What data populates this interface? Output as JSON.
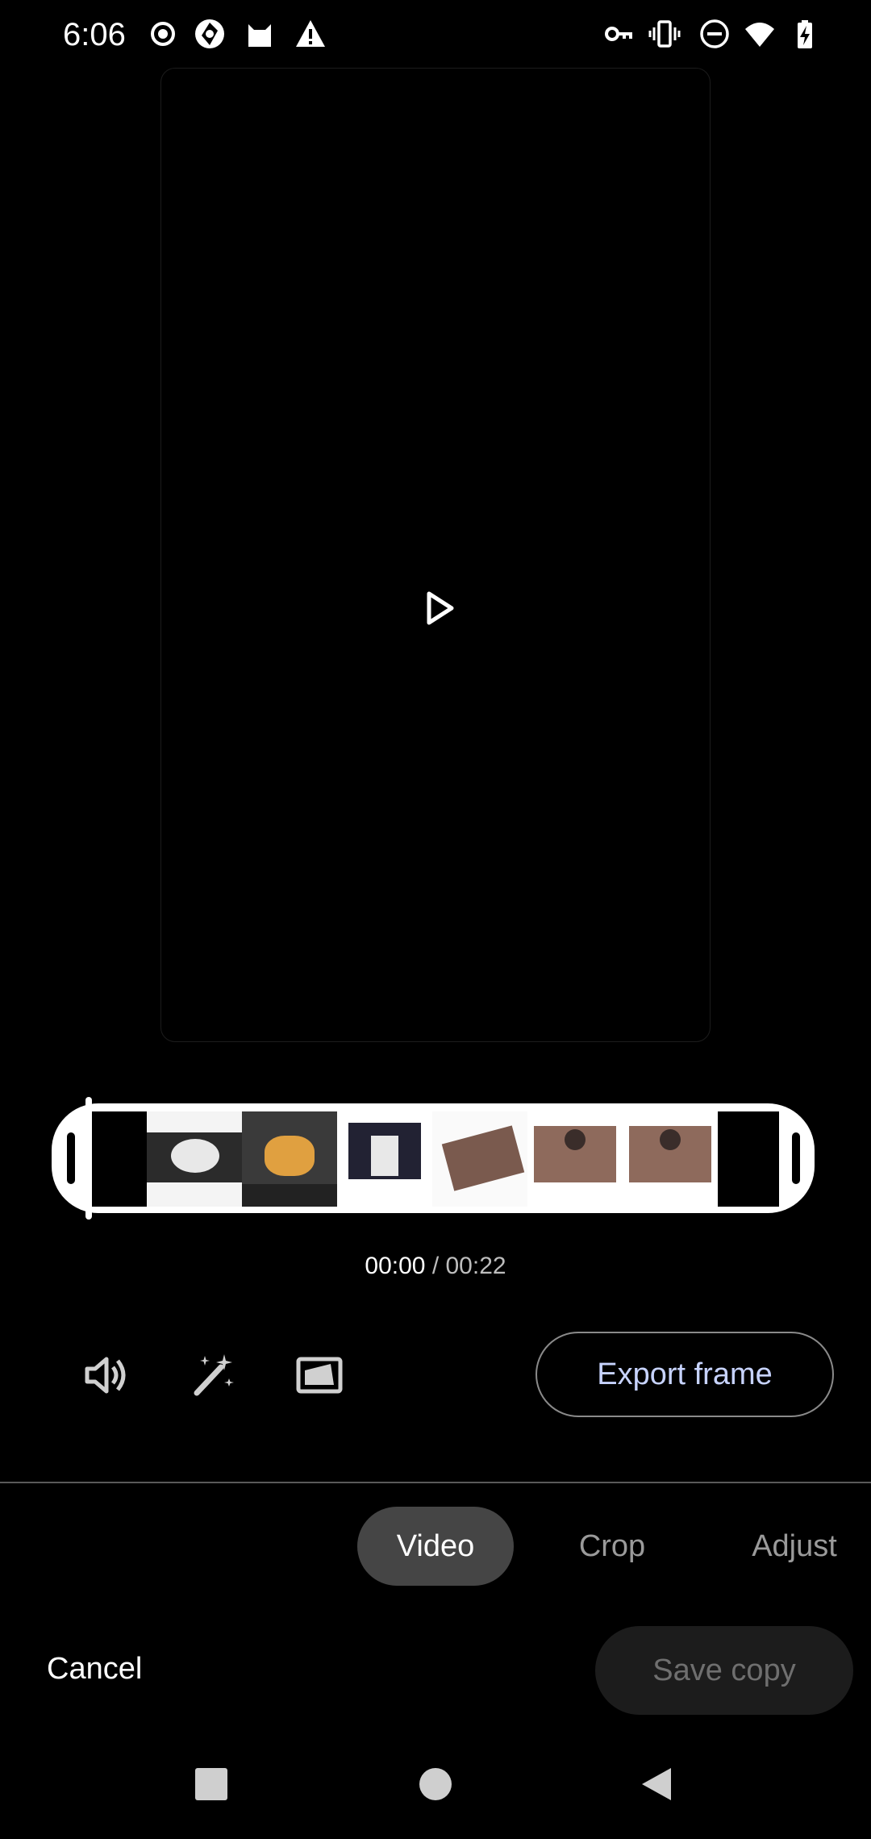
{
  "status_bar": {
    "time": "6:06",
    "left_icons": [
      "record-icon",
      "shutter-icon",
      "cat-icon",
      "warning-icon"
    ],
    "right_icons": [
      "vpn-key-icon",
      "vibrate-icon",
      "dnd-icon",
      "wifi-icon",
      "battery-charging-icon"
    ]
  },
  "player": {
    "play_icon": "play-icon"
  },
  "timeline": {
    "current_time": "00:00",
    "separator": " / ",
    "total_time": "00:22"
  },
  "tools": {
    "icons": [
      "volume-icon",
      "magic-wand-icon",
      "aspect-ratio-icon"
    ],
    "export_label": "Export frame"
  },
  "tabs": [
    {
      "label": "Video",
      "active": true
    },
    {
      "label": "Crop",
      "active": false
    },
    {
      "label": "Adjust",
      "active": false
    }
  ],
  "footer": {
    "cancel_label": "Cancel",
    "save_label": "Save copy"
  },
  "nav_bar": {
    "icons": [
      "recents-icon",
      "home-icon",
      "back-icon"
    ]
  },
  "colors": {
    "background": "#000000",
    "accent_text": "#c7d3ff",
    "active_tab": "#454545"
  }
}
